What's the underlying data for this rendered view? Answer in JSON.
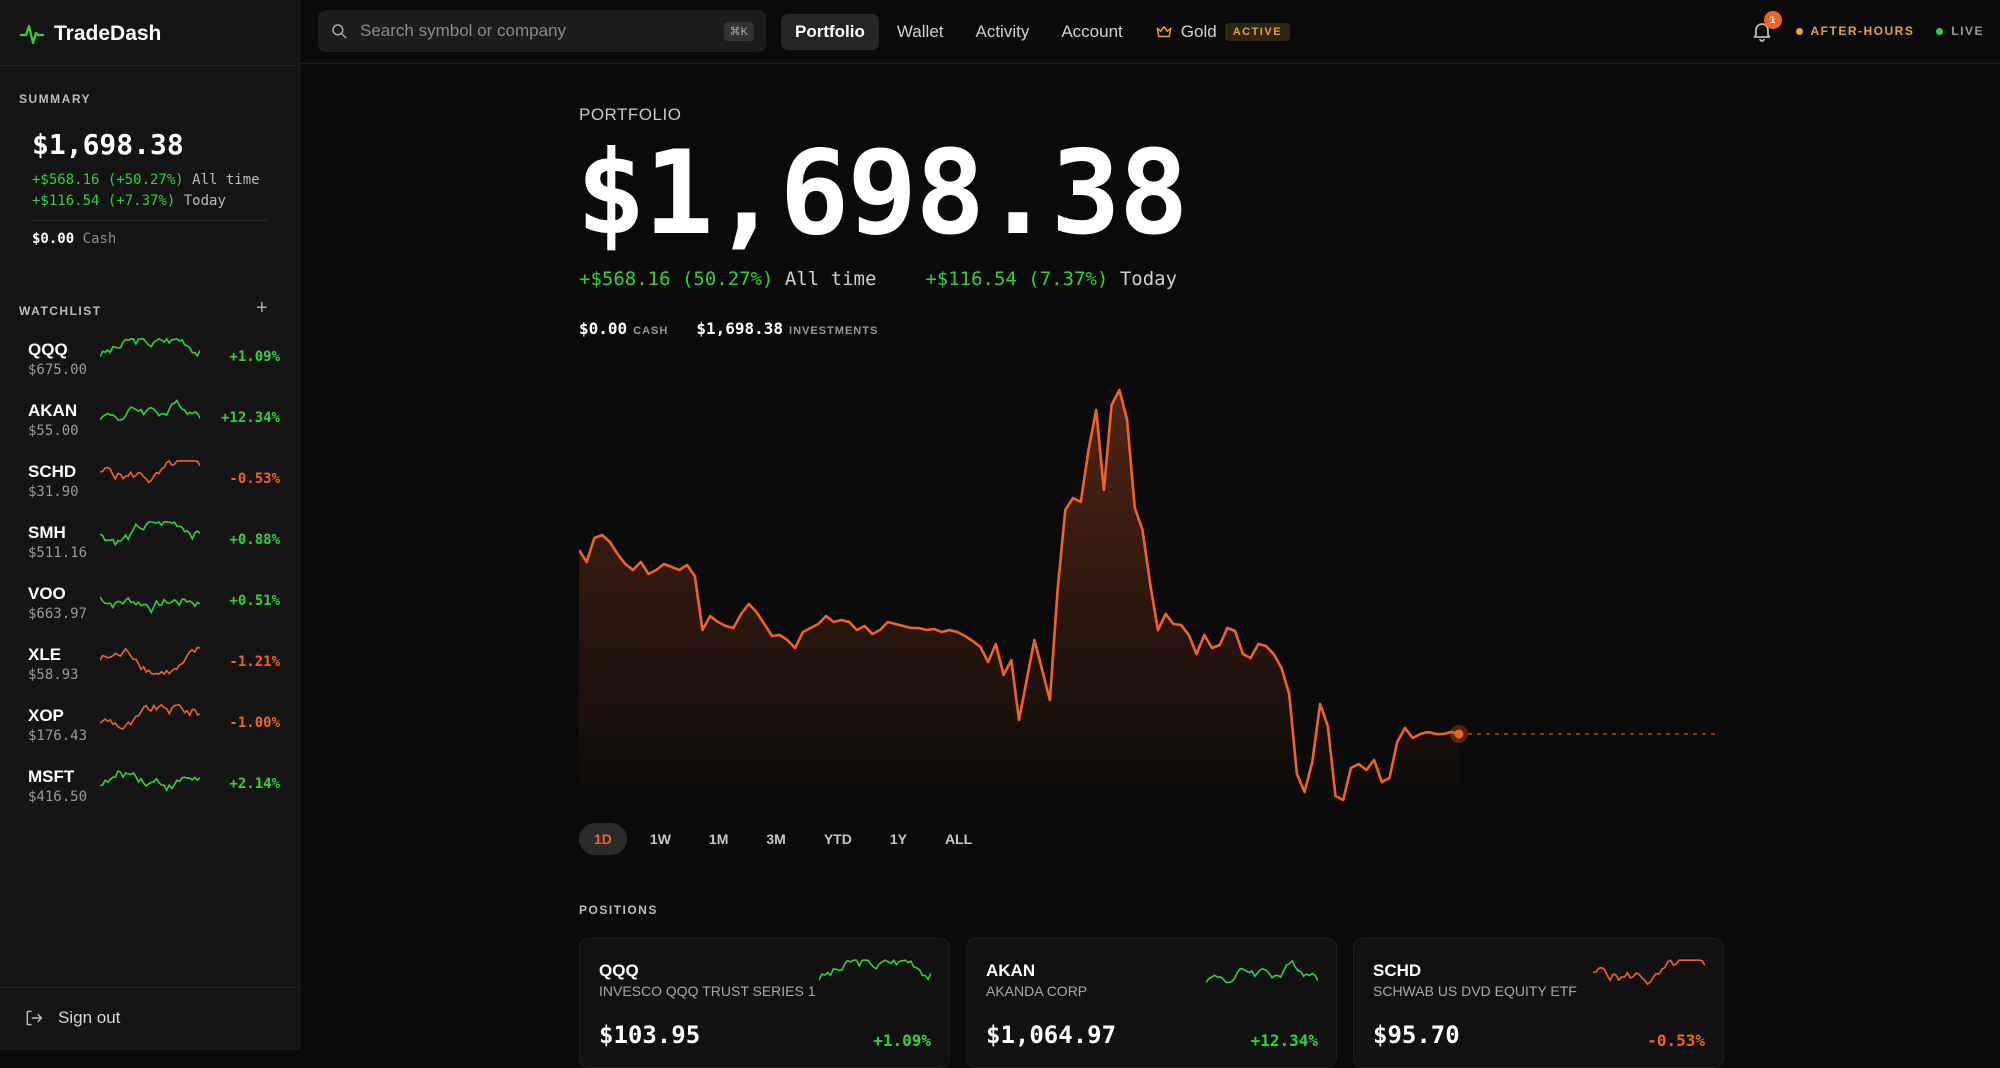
{
  "brand": "TradeDash",
  "colors": {
    "green": "#2fd33a",
    "red": "#f26322",
    "gold": "#e7a33a"
  },
  "summary": {
    "label": "SUMMARY",
    "value": "$1,698.38",
    "all_time_change": "+$568.16 (+50.27%)",
    "all_time_label": "All time",
    "today_change": "+$116.54 (+7.37%)",
    "today_label": "Today",
    "cash_value": "$0.00",
    "cash_label": "Cash"
  },
  "watchlist": {
    "label": "WATCHLIST",
    "add_icon": "+",
    "items": [
      {
        "symbol": "QQQ",
        "price": "$675.00",
        "change": "+1.09%",
        "trend": "up"
      },
      {
        "symbol": "AKAN",
        "price": "$55.00",
        "change": "+12.34%",
        "trend": "up"
      },
      {
        "symbol": "SCHD",
        "price": "$31.90",
        "change": "-0.53%",
        "trend": "down"
      },
      {
        "symbol": "SMH",
        "price": "$511.16",
        "change": "+0.88%",
        "trend": "up"
      },
      {
        "symbol": "VOO",
        "price": "$663.97",
        "change": "+0.51%",
        "trend": "up"
      },
      {
        "symbol": "XLE",
        "price": "$58.93",
        "change": "-1.21%",
        "trend": "down"
      },
      {
        "symbol": "XOP",
        "price": "$176.43",
        "change": "-1.00%",
        "trend": "down"
      },
      {
        "symbol": "MSFT",
        "price": "$416.50",
        "change": "+2.14%",
        "trend": "up"
      }
    ]
  },
  "sign_out": "Sign out",
  "search": {
    "placeholder": "Search symbol or company",
    "shortcut": "⌘K"
  },
  "nav": {
    "portfolio": "Portfolio",
    "wallet": "Wallet",
    "activity": "Activity",
    "account": "Account",
    "gold": "Gold",
    "gold_badge": "ACTIVE"
  },
  "topright": {
    "notifications": "1",
    "market_status": "AFTER-HOURS",
    "live": "LIVE"
  },
  "portfolio": {
    "label": "PORTFOLIO",
    "value": "$1,698.38",
    "all_time_change": "+$568.16 (50.27%)",
    "all_time_label": "All time",
    "today_change": "+$116.54 (7.37%)",
    "today_label": "Today",
    "cash_value": "$0.00",
    "cash_label": "CASH",
    "investments_value": "$1,698.38",
    "investments_label": "INVESTMENTS"
  },
  "chart_data": {
    "type": "line",
    "series": [
      {
        "values": [
          1600,
          1588,
          1612,
          1615,
          1608,
          1596,
          1586,
          1580,
          1588,
          1576,
          1580,
          1586,
          1583,
          1580,
          1585,
          1574,
          1520,
          1534,
          1528,
          1524,
          1522,
          1536,
          1546,
          1538,
          1526,
          1514,
          1515,
          1510,
          1502,
          1518,
          1522,
          1526,
          1534,
          1528,
          1530,
          1528,
          1520,
          1524,
          1516,
          1520,
          1528,
          1526,
          1524,
          1522,
          1522,
          1520,
          1521,
          1518,
          1520,
          1518,
          1514,
          1509,
          1503,
          1488,
          1506,
          1475,
          1490,
          1430,
          1470,
          1510,
          1480,
          1450,
          1560,
          1640,
          1652,
          1648,
          1700,
          1740,
          1660,
          1745,
          1760,
          1730,
          1642,
          1620,
          1566,
          1520,
          1536,
          1526,
          1525,
          1515,
          1496,
          1515,
          1502,
          1505,
          1522,
          1519,
          1496,
          1492,
          1506,
          1504,
          1496,
          1482,
          1456,
          1376,
          1358,
          1388,
          1446,
          1424,
          1354,
          1350,
          1382,
          1386,
          1380,
          1390,
          1368,
          1372,
          1408,
          1422,
          1412,
          1416,
          1418,
          1416,
          1416,
          1418,
          1416
        ]
      }
    ],
    "yrange": [
      1340,
      1770
    ],
    "ranges": [
      "1D",
      "1W",
      "1M",
      "3M",
      "YTD",
      "1Y",
      "ALL"
    ],
    "active_range": "1D"
  },
  "positions": {
    "label": "POSITIONS",
    "items": [
      {
        "symbol": "QQQ",
        "name": "INVESCO QQQ TRUST SERIES 1",
        "value": "$103.95",
        "change": "+1.09%",
        "trend": "up"
      },
      {
        "symbol": "AKAN",
        "name": "AKANDA CORP",
        "value": "$1,064.97",
        "change": "+12.34%",
        "trend": "up"
      },
      {
        "symbol": "SCHD",
        "name": "SCHWAB US DVD EQUITY ETF",
        "value": "$95.70",
        "change": "-0.53%",
        "trend": "down"
      }
    ]
  }
}
